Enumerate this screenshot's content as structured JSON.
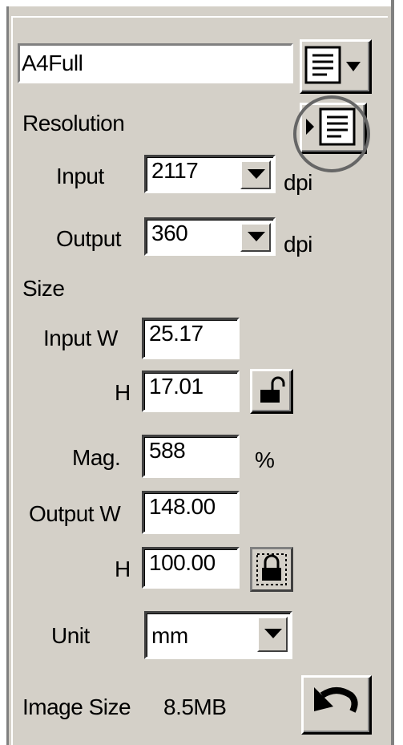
{
  "preset": {
    "value": "A4Full",
    "menu_icon": "list-menu-icon"
  },
  "resolution": {
    "heading": "Resolution",
    "expand_icon": "expand-list-icon",
    "input": {
      "label": "Input",
      "value": "2117",
      "unit": "dpi"
    },
    "output": {
      "label": "Output",
      "value": "360",
      "unit": "dpi"
    }
  },
  "size": {
    "heading": "Size",
    "input_w": {
      "label": "Input W",
      "value": "25.17"
    },
    "input_h": {
      "label": "H",
      "value": "17.01",
      "lock_icon": "unlocked-padlock-icon"
    },
    "mag": {
      "label": "Mag.",
      "value": "588",
      "unit": "%"
    },
    "output_w": {
      "label": "Output W",
      "value": "148.00"
    },
    "output_h": {
      "label": "H",
      "value": "100.00",
      "lock_icon": "locked-padlock-icon"
    }
  },
  "unit": {
    "label": "Unit",
    "value": "mm"
  },
  "image_size": {
    "label": "Image Size",
    "value": "8.5MB",
    "reset_icon": "undo-arrow-icon"
  }
}
